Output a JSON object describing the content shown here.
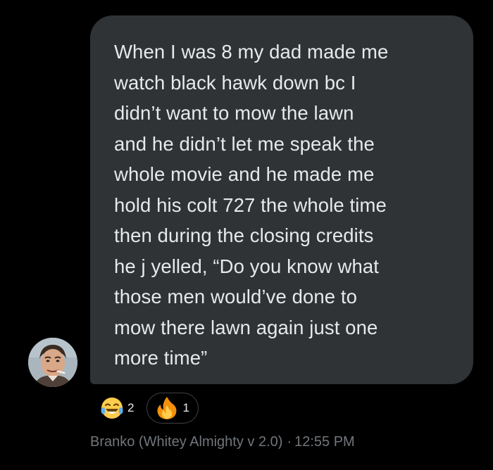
{
  "message": {
    "text": "When I was 8 my dad made me\nwatch black hawk down bc I\ndidn’t want to mow the lawn\nand he didn’t let me speak the\nwhole movie and he made me\nhold his colt 727 the whole time\nthen during the closing credits\nhe j yelled, “Do you know what\nthose men would’ve done to\nmow there lawn again just one\nmore time”"
  },
  "reactions": [
    {
      "icon": "laughing-tears-emoji-icon",
      "count": "2"
    },
    {
      "icon": "fire-emoji-icon",
      "count": "1"
    }
  ],
  "meta": {
    "sender": "Branko (Whitey Almighty v 2.0)",
    "separator": "·",
    "time": "12:55 PM"
  },
  "colors": {
    "background": "#000000",
    "bubble": "#2f3336",
    "text": "#e7e9ea",
    "meta_text": "#71767b"
  }
}
